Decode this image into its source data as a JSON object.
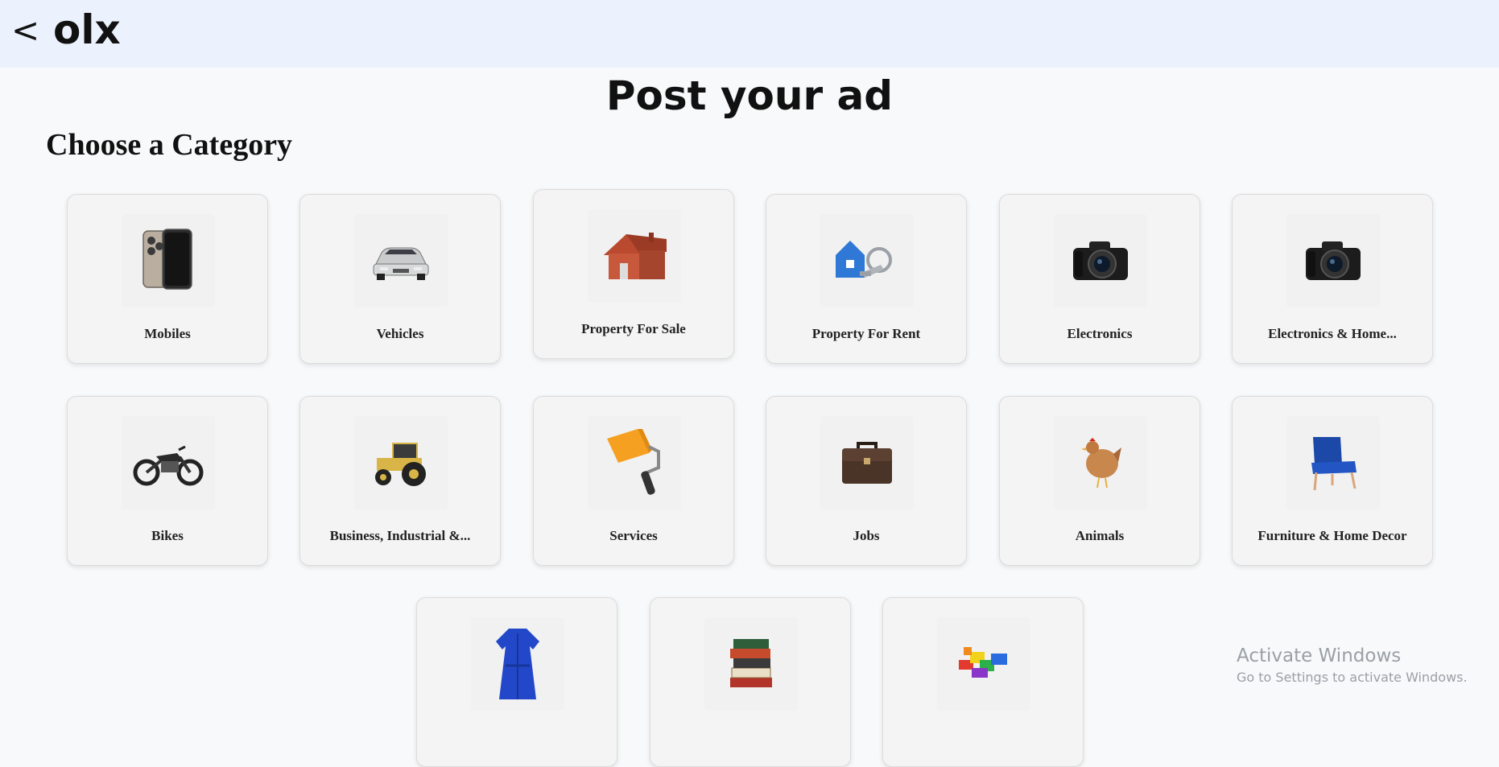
{
  "header": {
    "back_label": "<",
    "logo_text": "olx"
  },
  "page": {
    "title": "Post your ad",
    "section_title": "Choose a Category"
  },
  "categories": [
    {
      "label": "Mobiles",
      "icon": "mobile-phone-icon"
    },
    {
      "label": "Vehicles",
      "icon": "car-icon"
    },
    {
      "label": "Property For Sale",
      "icon": "house-icon"
    },
    {
      "label": "Property For Rent",
      "icon": "house-key-icon"
    },
    {
      "label": "Electronics",
      "icon": "camera-icon"
    },
    {
      "label": "Electronics & Home...",
      "icon": "camera-icon"
    },
    {
      "label": "Bikes",
      "icon": "motorcycle-icon"
    },
    {
      "label": "Business, Industrial &...",
      "icon": "tractor-icon"
    },
    {
      "label": "Services",
      "icon": "paint-roller-icon"
    },
    {
      "label": "Jobs",
      "icon": "briefcase-icon"
    },
    {
      "label": "Animals",
      "icon": "hen-icon"
    },
    {
      "label": "Furniture & Home Decor",
      "icon": "chair-icon"
    },
    {
      "label": "",
      "icon": "dress-icon"
    },
    {
      "label": "",
      "icon": "books-icon"
    },
    {
      "label": "",
      "icon": "building-blocks-icon"
    }
  ],
  "watermark": {
    "line1": "Activate Windows",
    "line2": "Go to Settings to activate Windows."
  },
  "colors": {
    "header_bg": "#ebf2fd",
    "page_bg": "#f8f9fa",
    "card_bg": "#f4f4f4"
  }
}
